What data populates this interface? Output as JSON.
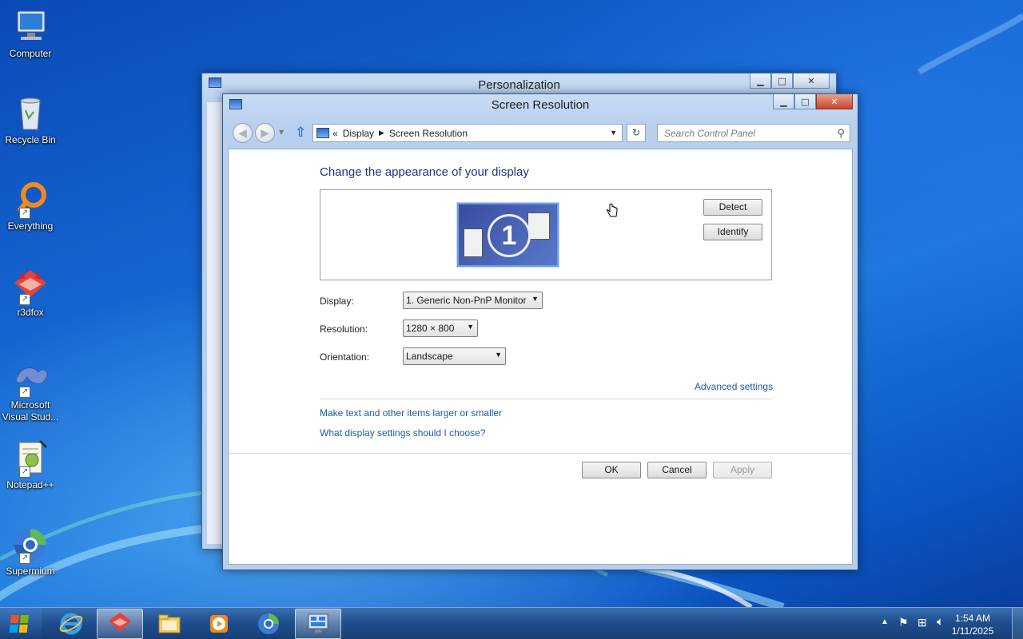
{
  "desktop": {
    "icons": [
      {
        "label": "Computer",
        "icon": "computer-icon"
      },
      {
        "label": "Recycle Bin",
        "icon": "recycle-bin-icon"
      },
      {
        "label": "Everything",
        "icon": "everything-icon"
      },
      {
        "label": "r3dfox",
        "icon": "r3dfox-icon"
      },
      {
        "label": "Microsoft Visual Stud...",
        "icon": "visual-studio-icon"
      },
      {
        "label": "Notepad++",
        "icon": "notepadpp-icon"
      },
      {
        "label": "Supermium",
        "icon": "supermium-icon"
      }
    ]
  },
  "back_window": {
    "title": "Personalization"
  },
  "window": {
    "title": "Screen Resolution",
    "breadcrumb": {
      "root_chevron": "«",
      "items": [
        "Display",
        "Screen Resolution"
      ]
    },
    "search_placeholder": "Search Control Panel",
    "heading": "Change the appearance of your display",
    "monitor_number": "1",
    "detect_label": "Detect",
    "identify_label": "Identify",
    "display_label": "Display:",
    "display_value": "1. Generic Non-PnP Monitor",
    "resolution_label": "Resolution:",
    "resolution_value": "1280 × 800",
    "orientation_label": "Orientation:",
    "orientation_value": "Landscape",
    "advanced_settings": "Advanced settings",
    "link_text_size": "Make text and other items larger or smaller",
    "link_help": "What display settings should I choose?",
    "ok_label": "OK",
    "cancel_label": "Cancel",
    "apply_label": "Apply"
  },
  "taskbar": {
    "pinned": [
      "internet-explorer-icon",
      "r3dfox-icon",
      "file-explorer-icon",
      "media-player-icon",
      "supermium-icon",
      "control-panel-icon"
    ],
    "clock_time": "1:54 AM",
    "clock_date": "1/11/2025"
  },
  "colors": {
    "accent": "#1e3287",
    "link": "#1f5aa6",
    "close_button": "#c7452b"
  }
}
